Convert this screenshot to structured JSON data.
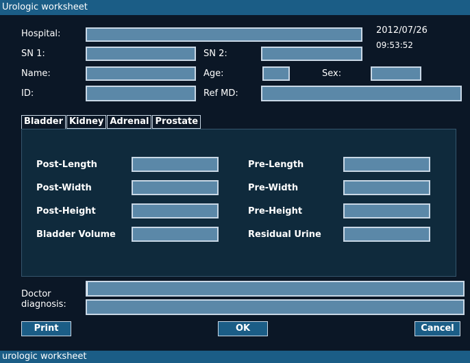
{
  "window": {
    "title": "Urologic worksheet",
    "status_text": "urologic worksheet"
  },
  "header": {
    "date": "2012/07/26",
    "time": "09:53:52",
    "labels": {
      "hospital": "Hospital:",
      "sn1": "SN 1:",
      "sn2": "SN 2:",
      "name": "Name:",
      "age": "Age:",
      "sex": "Sex:",
      "id": "ID:",
      "ref_md": "Ref MD:"
    },
    "values": {
      "hospital": "",
      "sn1": "",
      "sn2": "",
      "name": "",
      "age": "",
      "sex": "",
      "id": "",
      "ref_md": ""
    }
  },
  "tabs": [
    {
      "label": "Bladder",
      "active": true
    },
    {
      "label": "Kidney",
      "active": false
    },
    {
      "label": "Adrenal",
      "active": false
    },
    {
      "label": "Prostate",
      "active": false
    }
  ],
  "bladder": {
    "left": [
      {
        "label": "Post-Length",
        "value": ""
      },
      {
        "label": "Post-Width",
        "value": ""
      },
      {
        "label": "Post-Height",
        "value": ""
      },
      {
        "label": "Bladder Volume",
        "value": ""
      }
    ],
    "right": [
      {
        "label": "Pre-Length",
        "value": ""
      },
      {
        "label": "Pre-Width",
        "value": ""
      },
      {
        "label": "Pre-Height",
        "value": ""
      },
      {
        "label": "Residual Urine",
        "value": ""
      }
    ]
  },
  "diagnosis": {
    "label_line1": "Doctor",
    "label_line2": "diagnosis:",
    "line1": "",
    "line2": ""
  },
  "buttons": {
    "print": "Print",
    "ok": "OK",
    "cancel": "Cancel"
  }
}
